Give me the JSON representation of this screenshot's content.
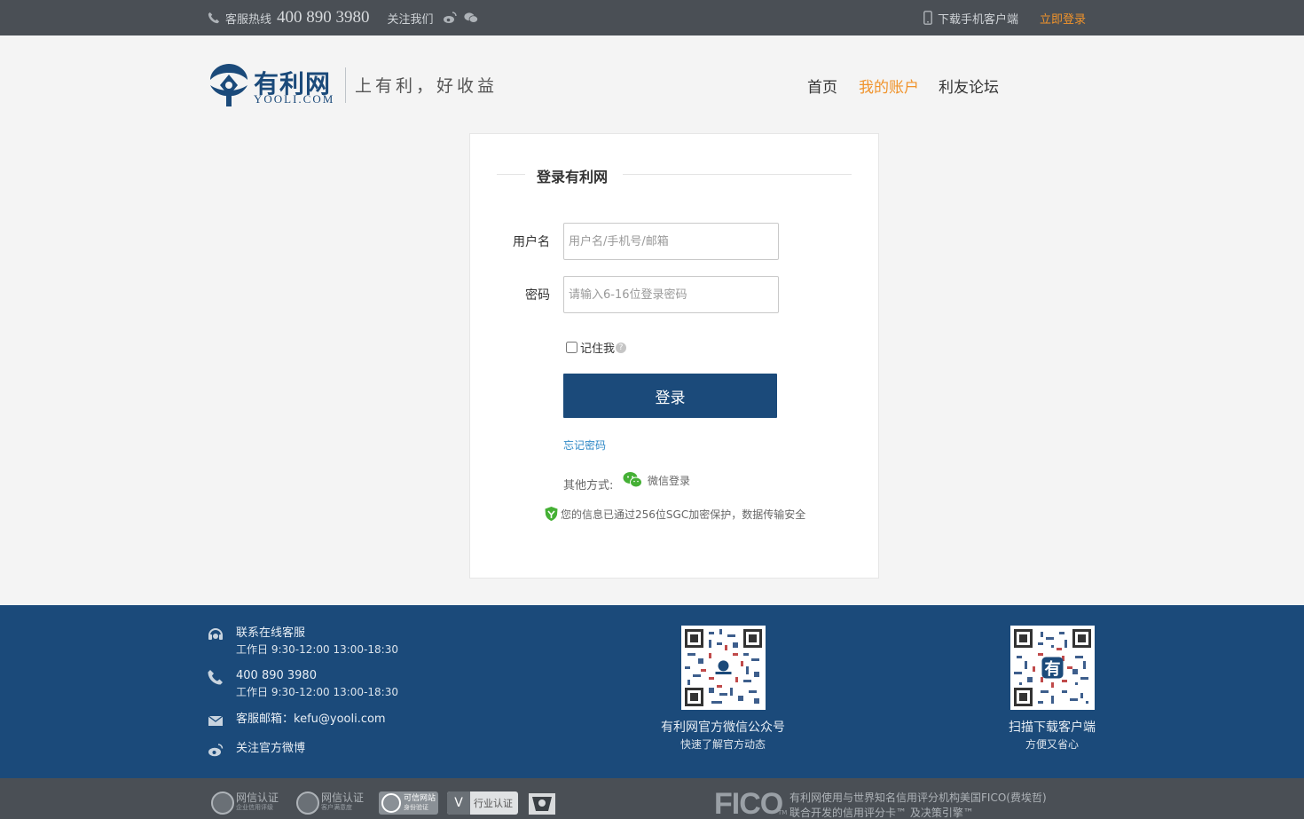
{
  "topbar": {
    "hotline_label": "客服热线",
    "hotline_number": "400 890 3980",
    "follow_label": "关注我们",
    "download_label": "下载手机客户端",
    "login_label": "立即登录"
  },
  "header": {
    "brand_cn": "有利网",
    "brand_en": "YOOLI.COM",
    "slogan": "上有利，好收益",
    "nav": [
      "首页",
      "我的账户",
      "利友论坛"
    ],
    "active_nav": "我的账户"
  },
  "login": {
    "title": "登录有利网",
    "username_label": "用户名",
    "username_placeholder": "用户名/手机号/邮箱",
    "password_label": "密码",
    "password_placeholder": "请输入6-16位登录密码",
    "remember_label": "记住我",
    "help_glyph": "?",
    "submit_label": "登录",
    "forgot_label": "忘记密码",
    "other_label": "其他方式:",
    "wechat_label": "微信登录",
    "secure_text": "您的信息已通过256位SGC加密保护，数据传输安全"
  },
  "footer": {
    "service_title": "联系在线客服",
    "service_hours": "工作日 9:30-12:00 13:00-18:30",
    "phone": "400 890 3980",
    "phone_hours": "工作日 9:30-12:00 13:00-18:30",
    "email": "客服邮箱：kefu@yooli.com",
    "weibo": "关注官方微博",
    "qr1_title": "有利网官方微信公众号",
    "qr1_sub": "快速了解官方动态",
    "qr2_title": "扫描下载客户端",
    "qr2_sub": "方便又省心"
  },
  "bottom": {
    "badge1_title": "网信认证",
    "badge1_sub": "企业信用评级",
    "badge2_title": "网信认证",
    "badge2_sub": "客户满意度",
    "badge3_title": "可信网站",
    "badge3_sub": "身份验证",
    "badge4_title": "行业认证",
    "fico_logo": "FICO",
    "fico_tm": "TM",
    "fico_line1": "有利网使用与世界知名信用评分机构美国FICO(费埃哲)",
    "fico_line2": "联合开发的信用评分卡™ 及决策引擎™"
  },
  "colors": {
    "brand_blue": "#1b4a7a",
    "accent_orange": "#f0932b",
    "link_blue": "#2e88c6",
    "bar_gray": "#4a4f55"
  }
}
